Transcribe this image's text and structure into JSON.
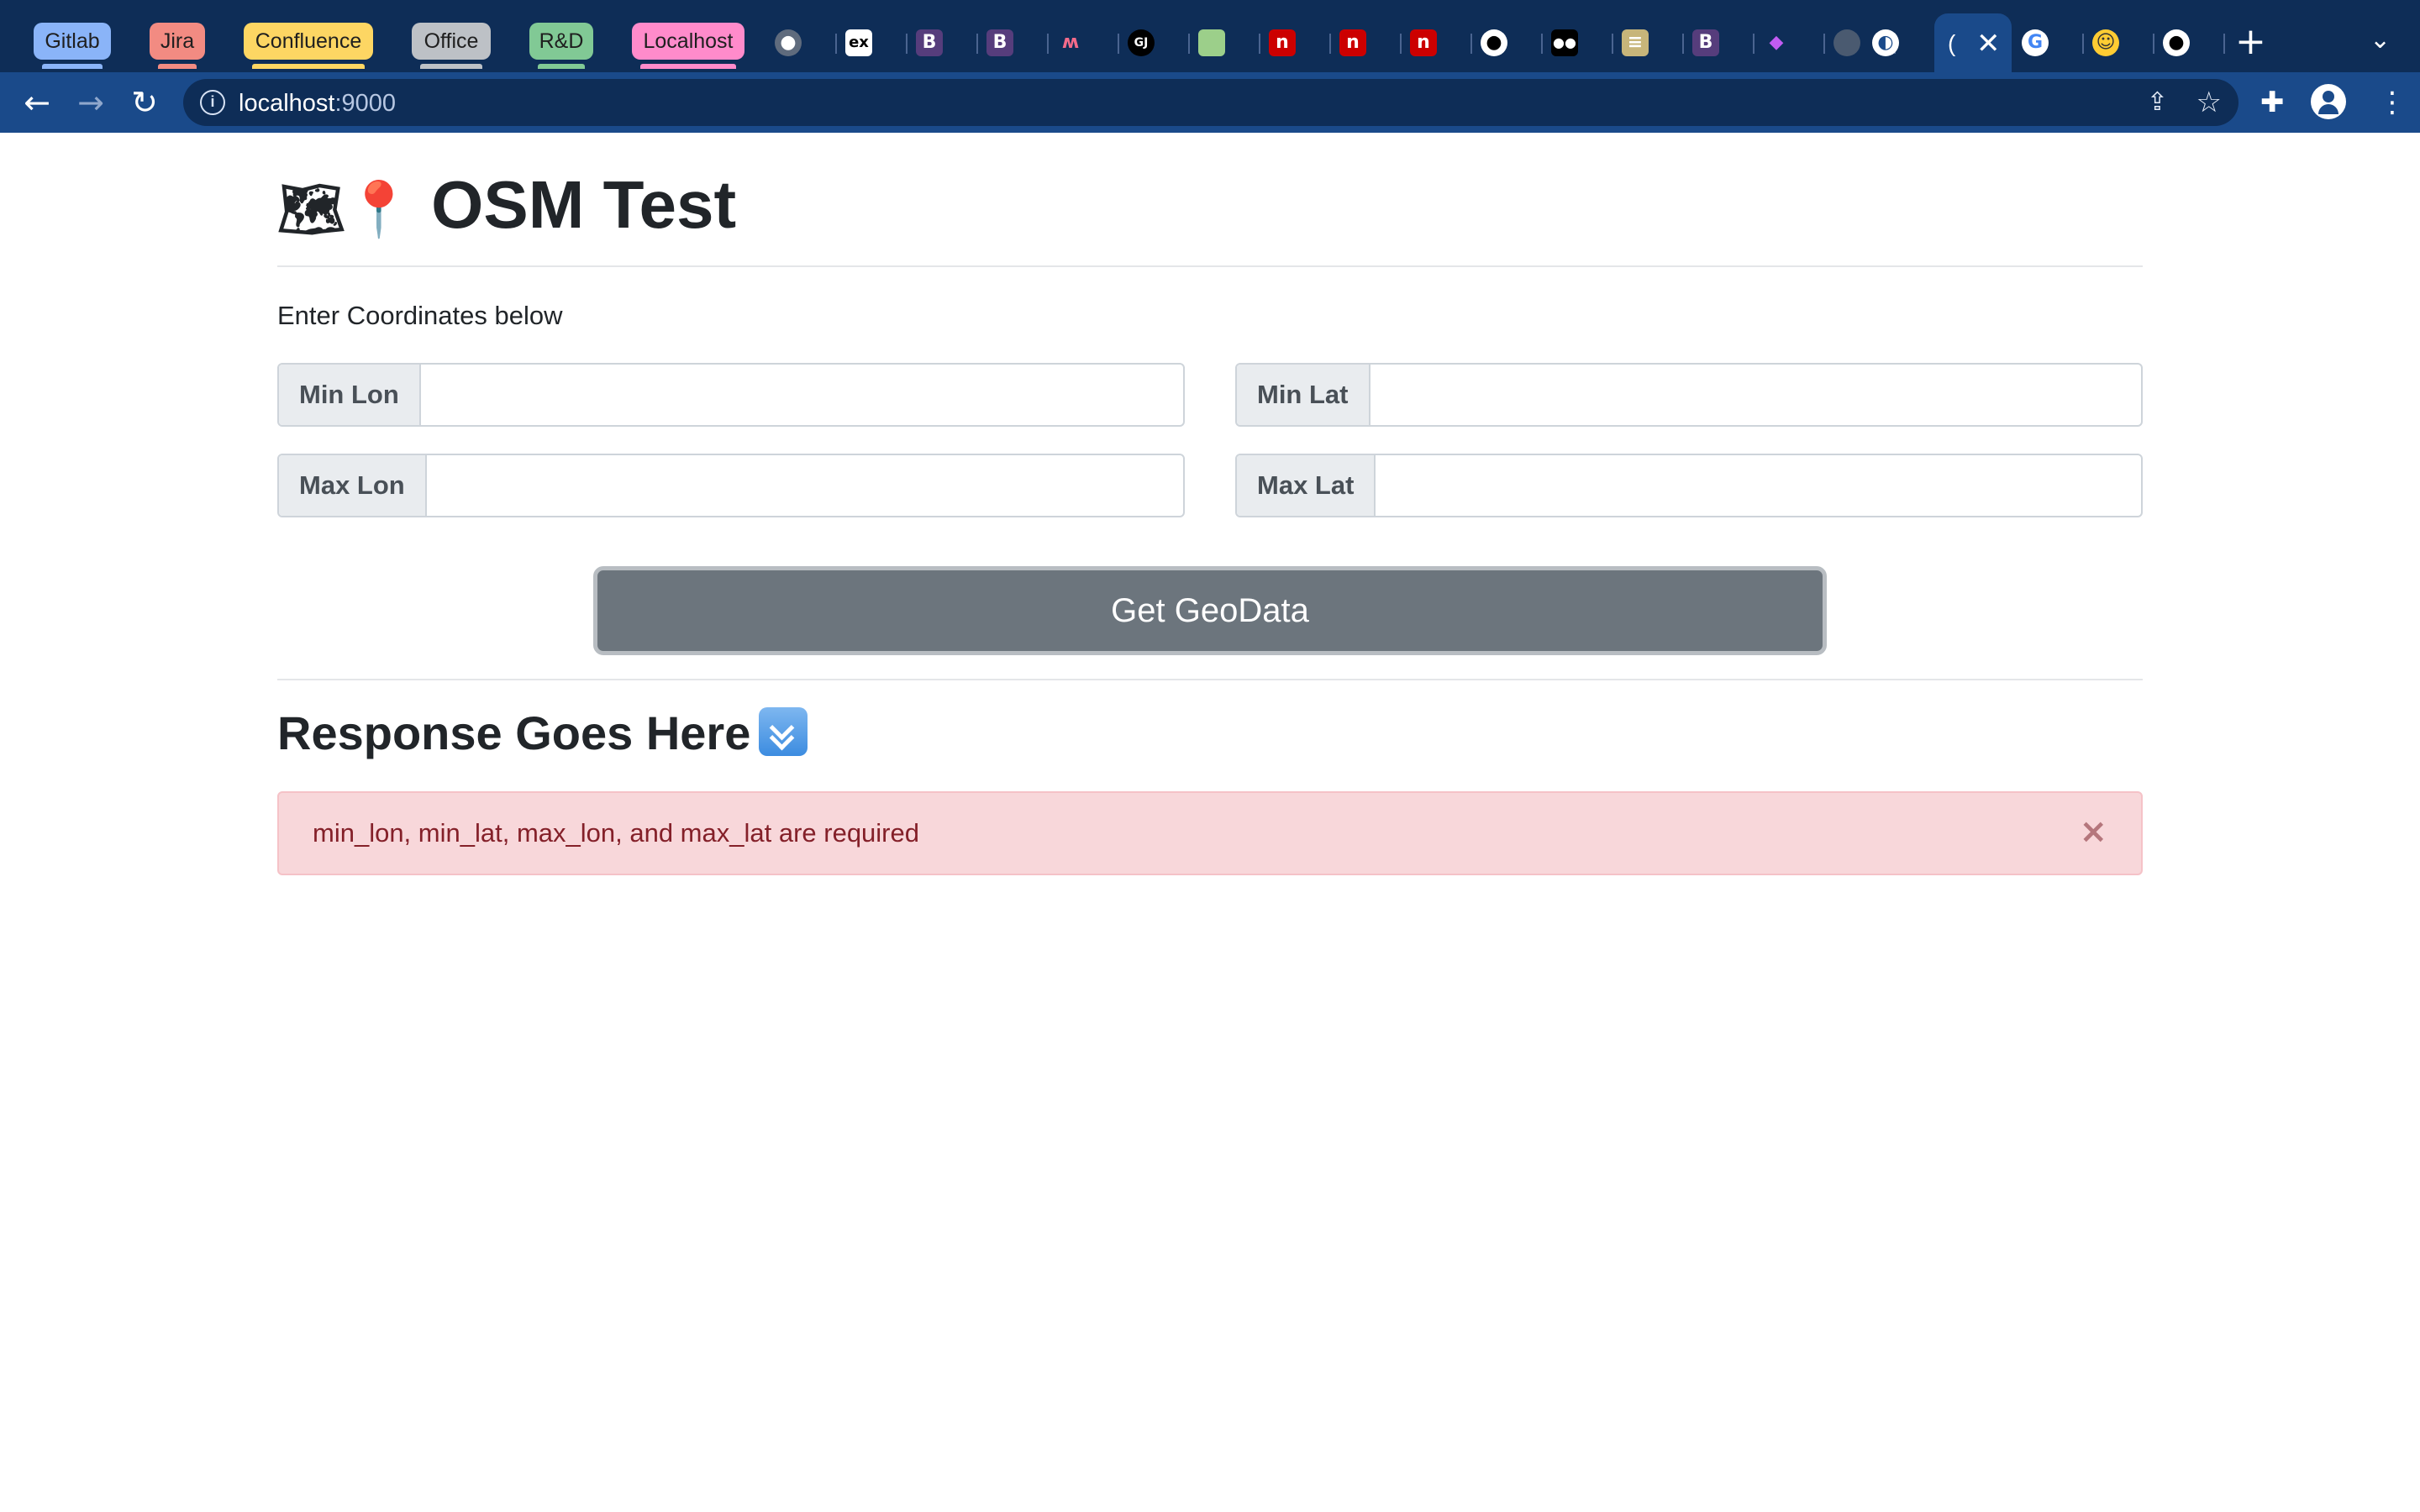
{
  "browser": {
    "tab_groups": [
      {
        "label": "Gitlab",
        "color": "#8ab4f8"
      },
      {
        "label": "Jira",
        "color": "#f28b82"
      },
      {
        "label": "Confluence",
        "color": "#fdd663"
      },
      {
        "label": "Office",
        "color": "#bdc1c6"
      },
      {
        "label": "R&D",
        "color": "#81c995"
      },
      {
        "label": "Localhost",
        "color": "#ff8bcb"
      }
    ],
    "active_tab_favicon": "globe-icon",
    "url_host": "localhost",
    "url_port": ":9000",
    "new_tab_label": "+"
  },
  "page": {
    "title": "OSM Test",
    "title_icons": [
      "world-map-icon",
      "round-pushpin-icon"
    ],
    "lead": "Enter Coordinates below",
    "fields": {
      "min_lon": {
        "label": "Min Lon",
        "value": ""
      },
      "min_lat": {
        "label": "Min Lat",
        "value": ""
      },
      "max_lon": {
        "label": "Max Lon",
        "value": ""
      },
      "max_lat": {
        "label": "Max Lat",
        "value": ""
      }
    },
    "submit_label": "Get GeoData",
    "response_title": "Response Goes Here",
    "response_icon": "double-down-arrow-icon",
    "alert": {
      "message": "min_lon, min_lat, max_lon, and max_lat are required",
      "close_label": "×"
    }
  },
  "colors": {
    "chrome_dark": "#0e2d57",
    "chrome_toolbar": "#1a4a8a",
    "button_secondary": "#6c757d",
    "alert_bg": "#f8d7da",
    "alert_text": "#842029"
  }
}
